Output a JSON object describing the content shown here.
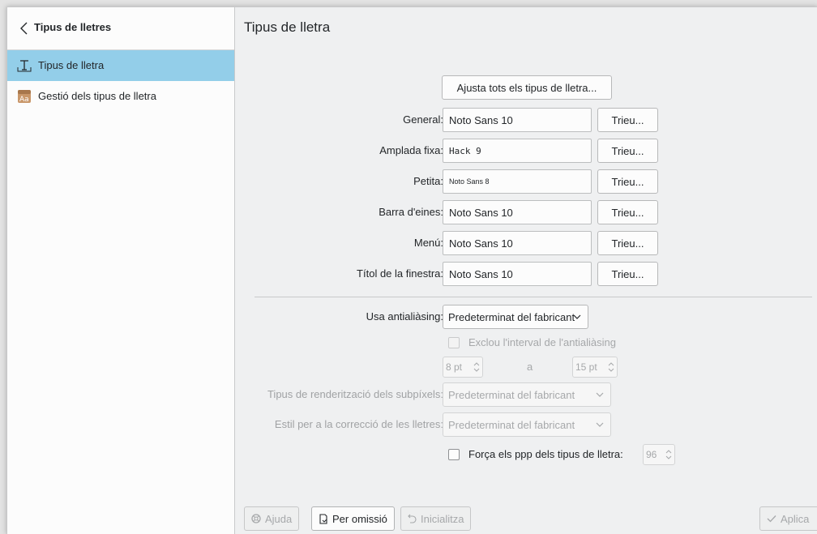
{
  "sidebar": {
    "header_title": "Tipus de lletres",
    "items": [
      {
        "label": "Tipus de lletra",
        "icon": "font-icon",
        "active": true
      },
      {
        "label": "Gestió dels tipus de lletra",
        "icon": "font-management-icon",
        "active": false
      }
    ]
  },
  "main": {
    "title": "Tipus de lletra",
    "adjust_all_button": "Ajusta tots els tipus de lletra...",
    "choose_label": "Trieu...",
    "fonts": [
      {
        "label": "General:",
        "value": "Noto Sans 10"
      },
      {
        "label": "Amplada fixa:",
        "value": "Hack  9"
      },
      {
        "label": "Petita:",
        "value": "Noto Sans 8"
      },
      {
        "label": "Barra d'eines:",
        "value": "Noto Sans 10"
      },
      {
        "label": "Menú:",
        "value": "Noto Sans 10"
      },
      {
        "label": "Títol de la finestra:",
        "value": "Noto Sans 10"
      }
    ],
    "antialiasing": {
      "label": "Usa antialiàsing:",
      "value": "Predeterminat del fabricant",
      "exclude_label": "Exclou l'interval de l'antialiàsing",
      "exclude_checked": false,
      "range_from": "8 pt",
      "range_sep": "a",
      "range_to": "15 pt"
    },
    "subpixel": {
      "label": "Tipus de renderització dels subpíxels:",
      "value": "Predeterminat del fabricant"
    },
    "hinting": {
      "label": "Estil per a la correcció de les lletres:",
      "value": "Predeterminat del fabricant"
    },
    "force_dpi": {
      "label": "Força els ppp dels tipus de lletra:",
      "checked": false,
      "value": "96"
    }
  },
  "footer": {
    "help": "Ajuda",
    "defaults": "Per omissió",
    "reset": "Inicialitza",
    "apply": "Aplica"
  },
  "colors": {
    "selection": "#93cee9",
    "window_bg": "#eff0f1",
    "sidebar_bg": "#fcfcfc"
  }
}
